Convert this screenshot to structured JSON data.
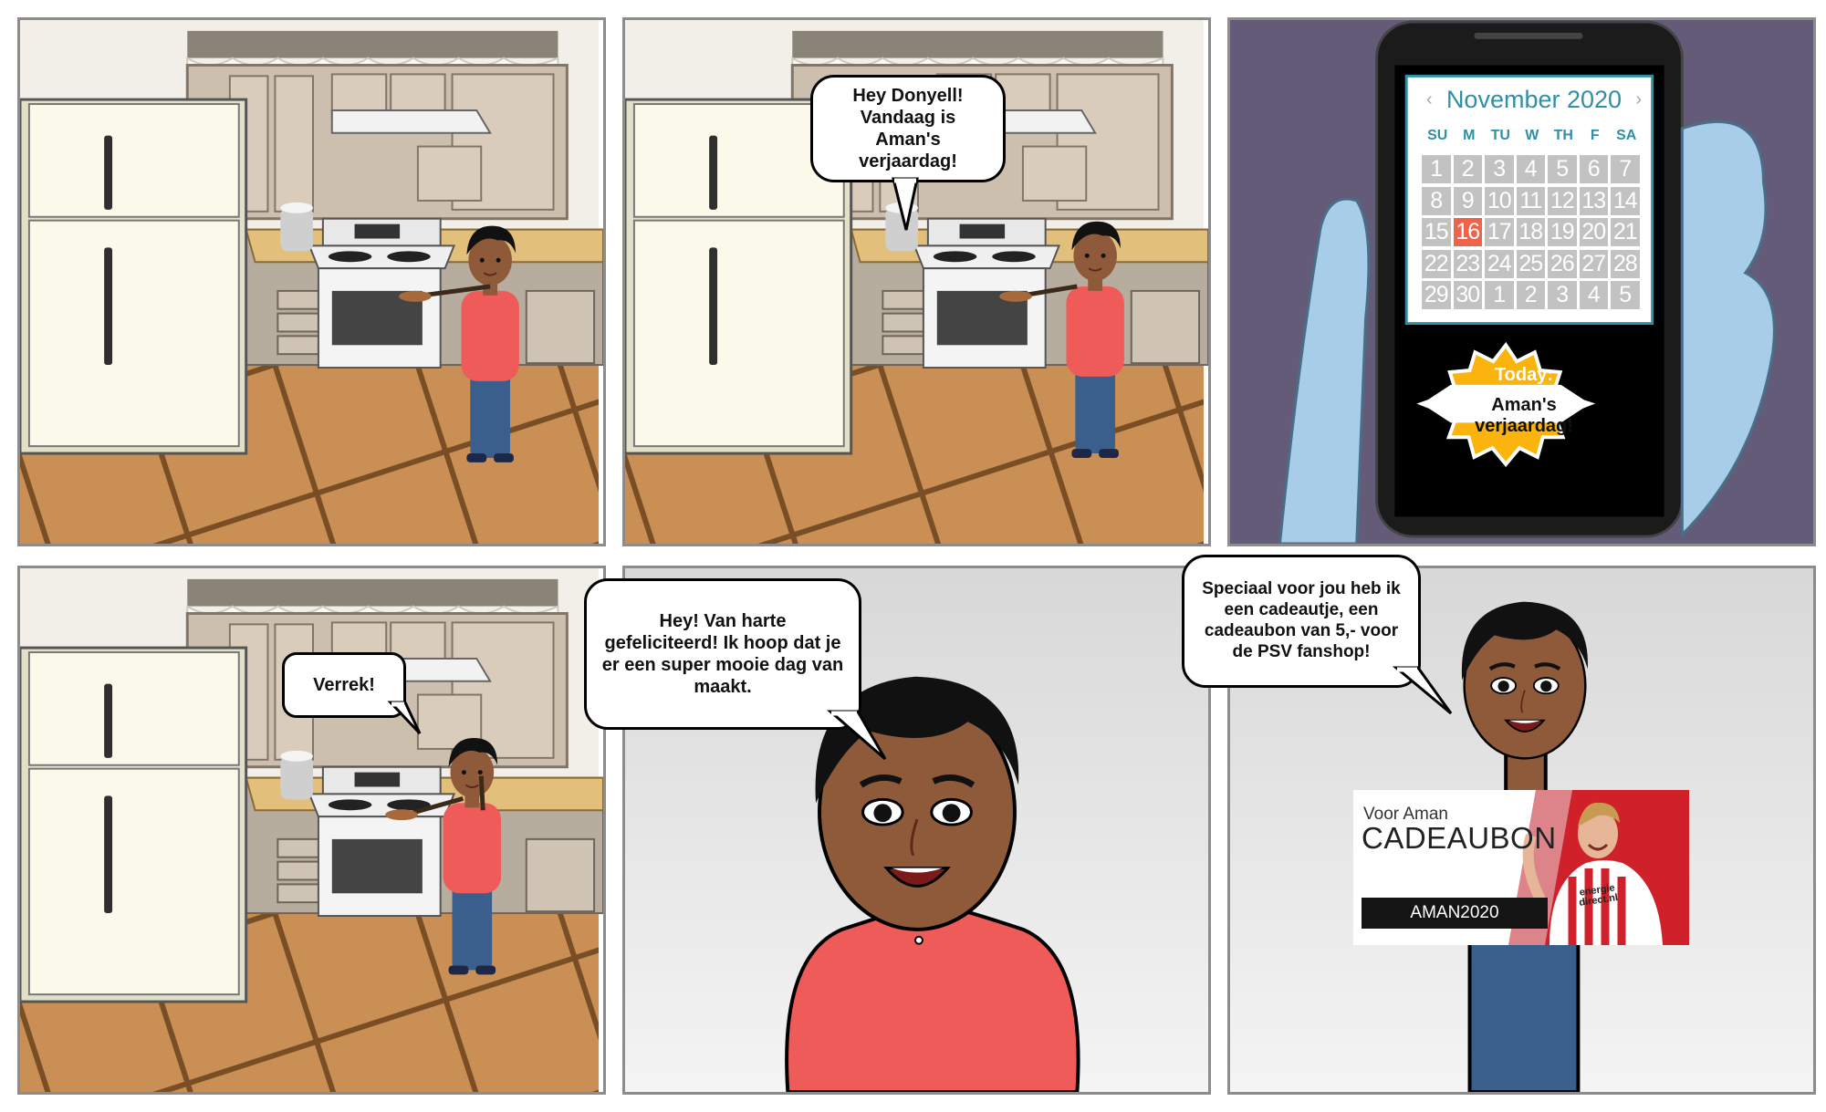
{
  "panel2": {
    "bubble": "Hey Donyell!\nVandaag is Aman's verjaardag!"
  },
  "panel3": {
    "calendar": {
      "month": "November 2020",
      "prev_icon": "chevron-left-icon",
      "next_icon": "chevron-right-icon",
      "weekdays": [
        "SU",
        "M",
        "TU",
        "W",
        "TH",
        "F",
        "SA"
      ],
      "days": [
        [
          "1",
          "2",
          "3",
          "4",
          "5",
          "6",
          "7"
        ],
        [
          "8",
          "9",
          "10",
          "11",
          "12",
          "13",
          "14"
        ],
        [
          "15",
          "16",
          "17",
          "18",
          "19",
          "20",
          "21"
        ],
        [
          "22",
          "23",
          "24",
          "25",
          "26",
          "27",
          "28"
        ],
        [
          "29",
          "30",
          "1",
          "2",
          "3",
          "4",
          "5"
        ]
      ],
      "highlight_day": "16",
      "highlight_color": "#f0634a"
    },
    "badge": {
      "heading": "Today:",
      "text": "Aman's verjaardag!",
      "color": "#fbb40d"
    }
  },
  "panel4": {
    "bubble": "Verrek!"
  },
  "panel5": {
    "bubble": "Hey! Van harte gefeliciteerd! Ik hoop dat je er een super mooie dag van maakt."
  },
  "panel6": {
    "bubble": "Speciaal voor jou heb ik een cadeautje, een cadeaubon van 5,- voor de PSV  fanshop!",
    "voucher": {
      "to": "Voor Aman",
      "title": "CADEAUBON",
      "code": "AMAN2020",
      "shirt_text": "energie direct.nl",
      "accent": "#d0202a"
    }
  }
}
